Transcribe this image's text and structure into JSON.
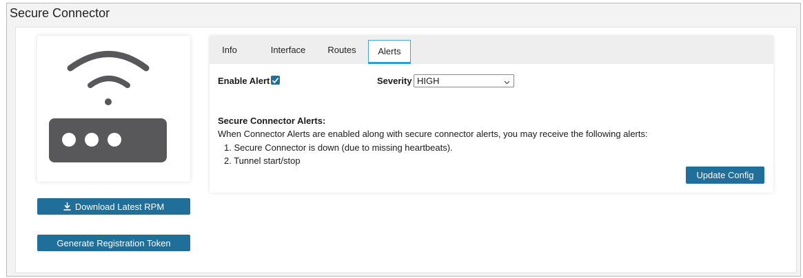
{
  "page": {
    "title": "Secure Connector"
  },
  "sidebar": {
    "device_icon": "wifi-router-icon",
    "download_label": "Download Latest RPM",
    "download_icon": "download-icon",
    "token_label": "Generate Registration Token"
  },
  "tabs": [
    {
      "label": "Info",
      "active": false
    },
    {
      "label": "Interface",
      "active": false
    },
    {
      "label": "Routes",
      "active": false
    },
    {
      "label": "Alerts",
      "active": true
    }
  ],
  "alerts": {
    "enable_label": "Enable Alert",
    "enable_checked": true,
    "severity_label": "Severity",
    "severity_value": "HIGH",
    "section_title": "Secure Connector Alerts:",
    "description": "When Connector Alerts are enabled along with secure connector alerts, you may receive the following alerts:",
    "items": [
      "1. Secure Connector is down (due to missing heartbeats).",
      "2. Tunnel start/stop"
    ],
    "update_label": "Update Config"
  },
  "colors": {
    "primary_button": "#1f6f9a",
    "active_tab_accent": "#2d9cdb",
    "icon_gray": "#58585a"
  }
}
